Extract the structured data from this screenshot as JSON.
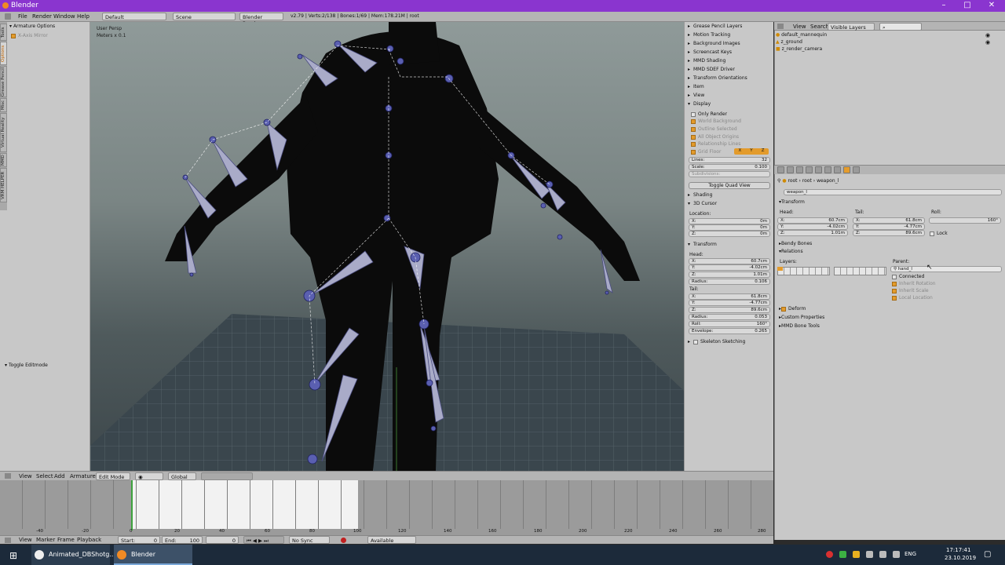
{
  "window": {
    "title": "Blender"
  },
  "infobar": {
    "menus": [
      "File",
      "Render",
      "Window",
      "Help"
    ],
    "layout": "Default",
    "scene": "Scene",
    "engine": "Blender Render",
    "stats": "v2.79 | Verts:2/138 | Bones:1/69 | Mem:178.21M | root"
  },
  "toolshelf": {
    "tabs": [
      "Tools",
      "Options",
      "Grease Pencil",
      "Misc",
      "Virtual Reality",
      "MMD",
      "VRM HELPER"
    ],
    "panel_title": "Armature Options",
    "xaxis_mirror": "X-Axis Mirror",
    "toggle_editmode": "Toggle Editmode"
  },
  "viewport": {
    "overlay_line1": "User Persp",
    "overlay_line2": "Meters x 0.1"
  },
  "npanel": {
    "sections_top": [
      "Grease Pencil Layers",
      "Motion Tracking",
      "Background Images",
      "Screencast Keys",
      "MMD Shading",
      "MMD SDEF Driver",
      "Transform Orientations",
      "Item",
      "View"
    ],
    "display_title": "Display",
    "display_opts": [
      "Only Render",
      "World Background",
      "Outline Selected",
      "All Object Origins",
      "Relationship Lines",
      "Grid Floor"
    ],
    "grid_axes": [
      "X",
      "Y",
      "Z"
    ],
    "lines_label": "Lines:",
    "lines_value": "32",
    "scale_label": "Scale:",
    "scale_value": "0.100",
    "subdivisions_label": "Subdivisions:",
    "toggle_quad": "Toggle Quad View",
    "shading": "Shading",
    "cursor_title": "3D Cursor",
    "location_label": "Location:",
    "cursor": {
      "x": "0m",
      "y": "0m",
      "z": "0m"
    },
    "transform_title": "Transform",
    "head_label": "Head:",
    "head": {
      "x": "60.7cm",
      "y": "-4.02cm",
      "z": "1.01m"
    },
    "radius_label": "Radius:",
    "head_radius": "0.106",
    "tail_label": "Tail:",
    "tail": {
      "x": "61.8cm",
      "y": "-4.77cm",
      "z": "89.6cm"
    },
    "tail_radius": "0.053",
    "roll_label": "Roll:",
    "roll": "160°",
    "envelope_label": "Envelope:",
    "envelope": "0.265",
    "skeleton_sketching": "Skeleton Sketching"
  },
  "outliner": {
    "menus": [
      "View",
      "Search"
    ],
    "filter": "Visible Layers",
    "items": [
      "default_mannequin",
      "z_ground",
      "z_render_camera"
    ]
  },
  "properties": {
    "breadcrumb": [
      "root",
      "root",
      "weapon_l"
    ],
    "bone_name": "weapon_l",
    "transform_title": "Transform",
    "head_label": "Head:",
    "tail_label": "Tail:",
    "roll_label": "Roll:",
    "head": {
      "x": "60.7cm",
      "y": "-4.02cm",
      "z": "1.01m"
    },
    "tail": {
      "x": "61.8cm",
      "y": "-4.77cm",
      "z": "89.6cm"
    },
    "roll": "160°",
    "lock": "Lock",
    "bendy": "Bendy Bones",
    "relations": "Relations",
    "layers_label": "Layers:",
    "parent_label": "Parent:",
    "parent": "hand_l",
    "rel_opts": [
      "Connected",
      "Inherit Rotation",
      "Inherit Scale",
      "Local Location"
    ],
    "deform": "Deform",
    "custom_props": "Custom Properties",
    "mmd_tools": "MMD Bone Tools"
  },
  "vheader": {
    "menus": [
      "View",
      "Select",
      "Add",
      "Armature"
    ],
    "mode": "Edit Mode",
    "orientation": "Global"
  },
  "timeline": {
    "ticks": [
      "-40",
      "-20",
      "0",
      "20",
      "40",
      "60",
      "80",
      "100",
      "120",
      "140",
      "160",
      "180",
      "200",
      "220",
      "240",
      "260",
      "280"
    ],
    "menus": [
      "View",
      "Marker",
      "Frame",
      "Playback"
    ],
    "start_label": "Start:",
    "start": "0",
    "end_label": "End:",
    "end": "100",
    "current": "0",
    "sync": "No Sync",
    "keying": "Available"
  },
  "taskbar": {
    "items": [
      "Animated_DBShotg...",
      "Blender"
    ],
    "lang": "ENG",
    "time": "17:17:41",
    "date": "23.10.2019"
  },
  "colors": {
    "accent": "#e39b2b",
    "titlebar": "#8a35cf",
    "taskbar": "#1c2a3a"
  }
}
